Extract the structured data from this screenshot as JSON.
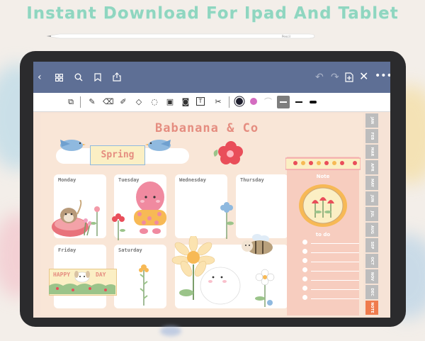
{
  "headline": "Instant Download For Ipad And Tablet",
  "pencil_brand": "Pencil",
  "planner": {
    "brand": "Babanana & Co",
    "season": "Spring",
    "note_title": "Note",
    "todo_title": "to do",
    "happy_day": {
      "left": "HAPPY",
      "right": "DAY"
    }
  },
  "days": [
    "Monday",
    "Tuesday",
    "Wednesday",
    "Thursday",
    "Friday",
    "Saturday"
  ],
  "months": [
    "JAN",
    "FEB",
    "MAR",
    "APR",
    "MAY",
    "JUN",
    "JUL",
    "AUG",
    "SEP",
    "OCT",
    "NOV",
    "DEC",
    "NOTE"
  ],
  "colors": {
    "topbar": "#5e6f95",
    "page": "#f9e6d7",
    "brand": "#e58d80",
    "accent_pink": "#f08aa0",
    "month_tab": "#bdbdbd",
    "note_tab": "#ef7b4d",
    "headline": "#8fd6c0"
  },
  "topbar_icons": [
    "back-icon",
    "grid-icon",
    "search-icon",
    "bookmark-icon",
    "share-icon",
    "undo-icon",
    "redo-icon",
    "add-page-icon",
    "close-icon",
    "more-icon"
  ],
  "tools": [
    "lasso-scan-icon",
    "pen-icon",
    "eraser-icon",
    "highlighter-icon",
    "shapes-icon",
    "lasso-icon",
    "image-icon",
    "camera-icon",
    "text-icon",
    "elements-icon"
  ]
}
